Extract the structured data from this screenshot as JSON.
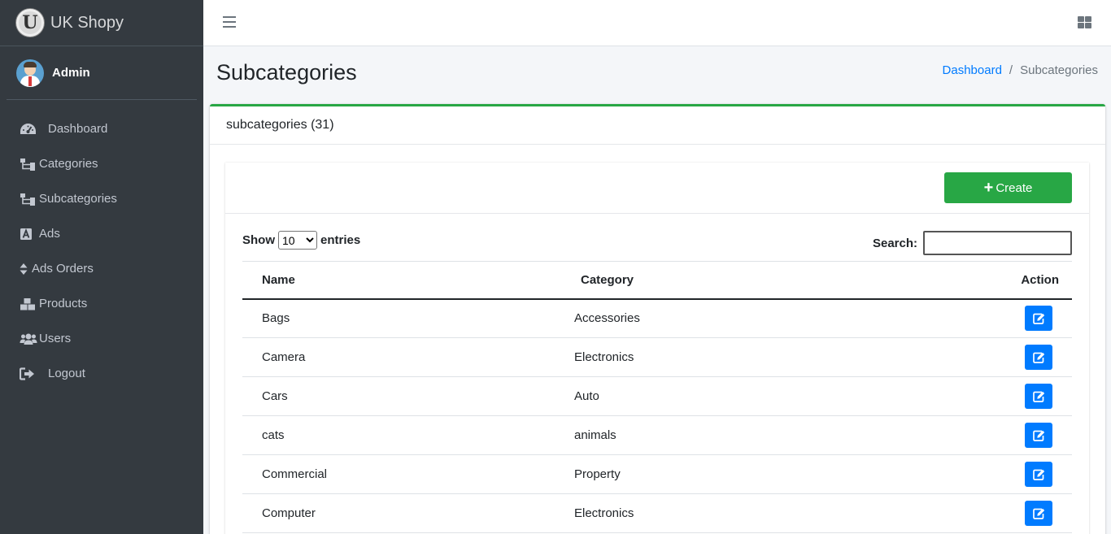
{
  "brand": {
    "name": "UK Shopy",
    "logo_letter": "U"
  },
  "user": {
    "name": "Admin"
  },
  "sidebar": {
    "items": [
      {
        "label": "Dashboard",
        "icon": "tachometer-icon"
      },
      {
        "label": "Categories",
        "icon": "sitemap-icon"
      },
      {
        "label": "Subcategories",
        "icon": "sitemap-icon"
      },
      {
        "label": "Ads",
        "icon": "ads-icon"
      },
      {
        "label": "Ads Orders",
        "icon": "sort-icon"
      },
      {
        "label": "Products",
        "icon": "boxes-icon"
      },
      {
        "label": "Users",
        "icon": "users-icon"
      },
      {
        "label": "Logout",
        "icon": "sign-out-icon"
      }
    ]
  },
  "header": {
    "title": "Subcategories",
    "breadcrumb": {
      "home": "Dashboard",
      "separator": "/",
      "current": "Subcategories"
    }
  },
  "card": {
    "title": "subcategories (31)",
    "accent_color": "#28a745",
    "create_label": "Create"
  },
  "table_controls": {
    "show_label": "Show",
    "entries_value": "10",
    "entries_label": "entries",
    "search_label": "Search:"
  },
  "table": {
    "columns": [
      "Name",
      "Category",
      "Action"
    ],
    "rows": [
      {
        "name": "Bags",
        "category": "Accessories"
      },
      {
        "name": "Camera",
        "category": "Electronics"
      },
      {
        "name": "Cars",
        "category": "Auto"
      },
      {
        "name": "cats",
        "category": "animals"
      },
      {
        "name": "Commercial",
        "category": "Property"
      },
      {
        "name": "Computer",
        "category": "Electronics"
      }
    ]
  }
}
